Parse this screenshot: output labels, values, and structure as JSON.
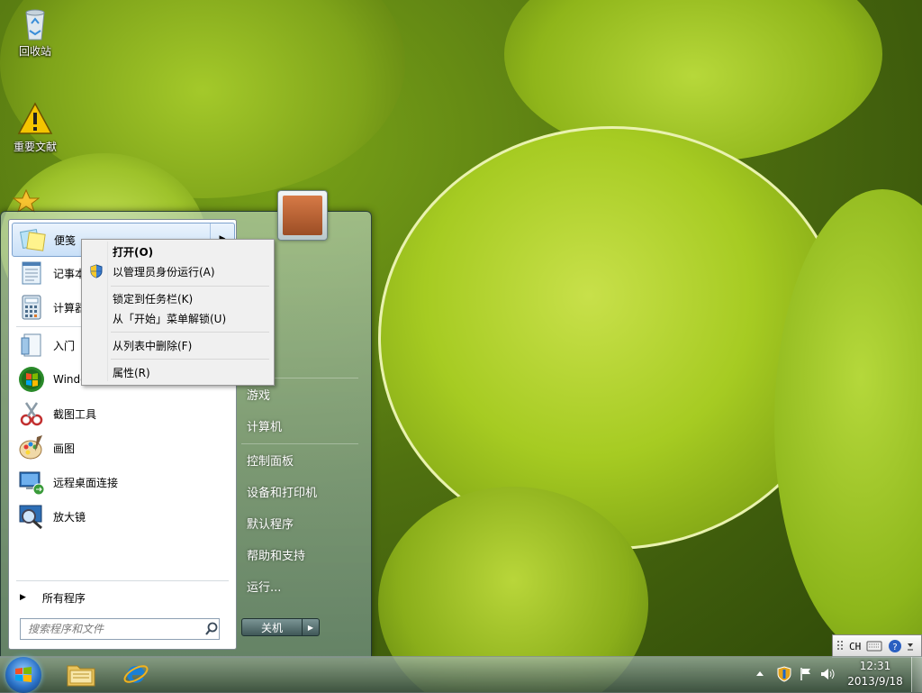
{
  "desktop": {
    "icons": [
      {
        "label": "回收站",
        "icon": "recycle-bin-icon"
      },
      {
        "label": "重要文献",
        "icon": "warning-icon"
      }
    ]
  },
  "start_menu": {
    "programs": [
      {
        "label": "便笺",
        "icon": "sticky-notes-icon"
      },
      {
        "label": "记事本",
        "icon": "notepad-icon"
      },
      {
        "label": "计算器",
        "icon": "calculator-icon"
      },
      {
        "label": "入门",
        "icon": "getting-started-icon"
      },
      {
        "label": "Windows Media Center",
        "icon": "windows-logo-icon"
      },
      {
        "label": "截图工具",
        "icon": "snipping-tool-icon"
      },
      {
        "label": "画图",
        "icon": "paint-icon"
      },
      {
        "label": "远程桌面连接",
        "icon": "remote-desktop-icon"
      },
      {
        "label": "放大镜",
        "icon": "magnifier-icon"
      }
    ],
    "all_programs": "所有程序",
    "search_placeholder": "搜索程序和文件",
    "right_items": [
      "游戏",
      "计算机",
      "控制面板",
      "设备和打印机",
      "默认程序",
      "帮助和支持",
      "运行..."
    ],
    "shutdown_label": "关机"
  },
  "context_menu": {
    "items": [
      "打开(O)",
      "以管理员身份运行(A)",
      "锁定到任务栏(K)",
      "从「开始」菜单解锁(U)",
      "从列表中删除(F)",
      "属性(R)"
    ]
  },
  "taskbar": {
    "pinned": [
      {
        "name": "explorer",
        "icon": "folder-icon"
      },
      {
        "name": "internet-explorer",
        "icon": "ie-icon"
      }
    ],
    "language": "CH",
    "time": "12:31",
    "date": "2013/9/18"
  },
  "colors": {
    "selection": "#c9e0f8",
    "menu_bg": "#f0f0f0",
    "taskbar": "#3c5046"
  }
}
